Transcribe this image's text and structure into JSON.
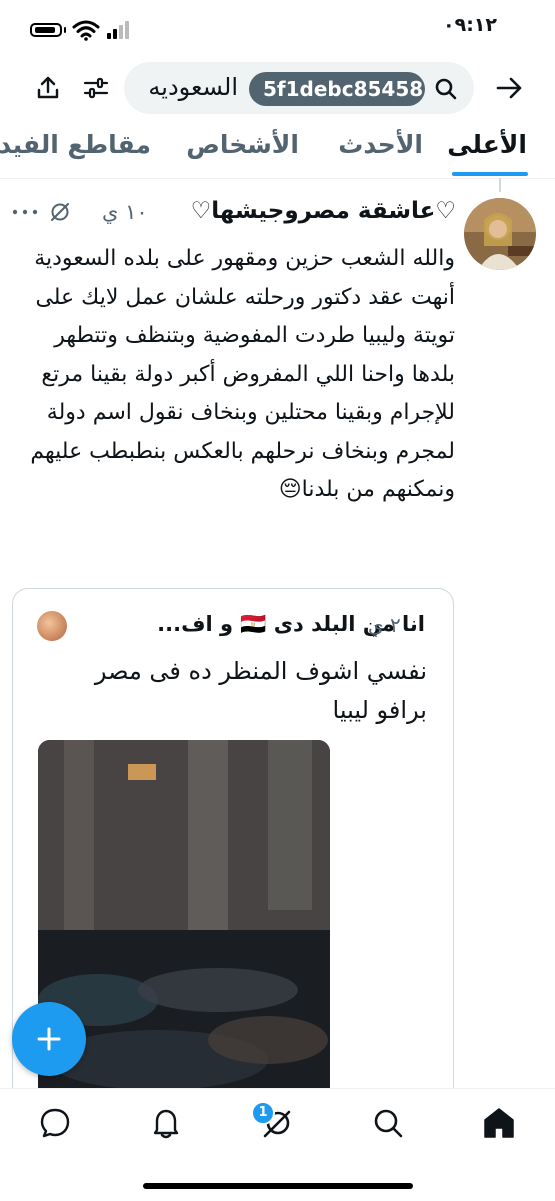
{
  "status_bar": {
    "time": "٠٩:١٢"
  },
  "search": {
    "query_text": "السعوديه",
    "chip_text": "5f1debc85458"
  },
  "tabs": [
    {
      "label": "الأعلى",
      "active": true
    },
    {
      "label": "الأحدث"
    },
    {
      "label": "الأشخاص"
    },
    {
      "label": "مقاطع الفيد"
    }
  ],
  "tweet": {
    "author": "♡عاشقة مصروجيشها♡",
    "time": "١٠ ي",
    "body": "والله الشعب حزين ومقهور على بلده السعودية أنهت عقد دكتور ورحلته علشان عمل لايك على تويتة وليبيا طردت المفوضية وبتنظف وتتطهر بلدها واحنا اللي المفروض أكبر دولة بقينا مرتع للإجرام وبقينا محتلين وبنخاف نقول اسم دولة لمجرم وبنخاف نرحلهم بالعكس بنطبطب عليهم ونمكنهم من بلدنا😔"
  },
  "quote": {
    "author": "انا من البلد دى 🇪🇬 و اف...",
    "time": "٢ ي",
    "body": "نفسي اشوف المنظر ده فى مصر برافو ليبيا"
  },
  "nav": {
    "badge_count": "1"
  },
  "colors": {
    "accent": "#1d9bf0",
    "text": "#0f1419",
    "muted": "#536471"
  }
}
